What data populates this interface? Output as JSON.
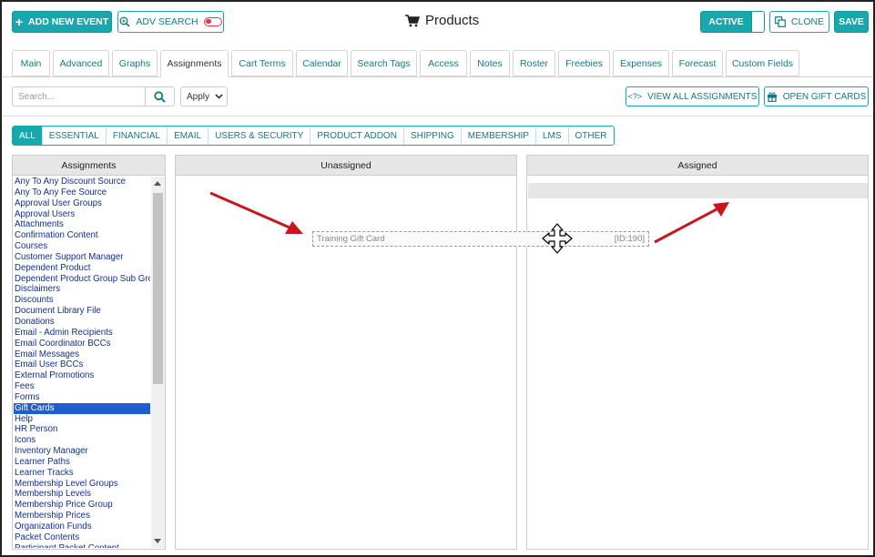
{
  "header": {
    "add_event_label": "ADD NEW EVENT",
    "adv_search_label": "ADV SEARCH",
    "title": "Products",
    "active_label": "ACTIVE",
    "clone_label": "CLONE",
    "save_label": "SAVE"
  },
  "tabs": [
    "Main",
    "Advanced",
    "Graphs",
    "Assignments",
    "Cart Terms",
    "Calendar",
    "Search Tags",
    "Access",
    "Notes",
    "Roster",
    "Freebies",
    "Expenses",
    "Forecast",
    "Custom Fields"
  ],
  "active_tab": "Assignments",
  "toolbar": {
    "search_placeholder": "Search...",
    "apply_label": "Apply",
    "view_all_label": "VIEW ALL ASSIGNMENTS",
    "view_all_glyph": "<?>",
    "gift_cards_label": "OPEN GIFT CARDS"
  },
  "filters": [
    "ALL",
    "ESSENTIAL",
    "FINANCIAL",
    "EMAIL",
    "USERS & SECURITY",
    "PRODUCT ADDON",
    "SHIPPING",
    "MEMBERSHIP",
    "LMS",
    "OTHER"
  ],
  "active_filter": "ALL",
  "panels": {
    "assignments_title": "Assignments",
    "unassigned_title": "Unassigned",
    "assigned_title": "Assigned"
  },
  "assignment_list": [
    "Any To Any Discount Source",
    "Any To Any Fee Source",
    "Approval User Groups",
    "Approval Users",
    "Attachments",
    "Confirmation Content",
    "Courses",
    "Customer Support Manager",
    "Dependent Product",
    "Dependent Product Group Sub Group",
    "Disclaimers",
    "Discounts",
    "Document Library File",
    "Donations",
    "Email - Admin Recipients",
    "Email Coordinator BCCs",
    "Email Messages",
    "Email User BCCs",
    "External Promotions",
    "Fees",
    "Forms",
    "Gift Cards",
    "Help",
    "HR Person",
    "Icons",
    "Inventory Manager",
    "Learner Paths",
    "Learner Tracks",
    "Membership Level Groups",
    "Membership Levels",
    "Membership Price Group",
    "Membership Prices",
    "Organization Funds",
    "Packet Contents",
    "Participant Packet Content"
  ],
  "selected_item": "Gift Cards",
  "dragged_item": {
    "name": "Training Gift Card",
    "id_label": "[ID:190]"
  },
  "colors": {
    "accent": "#17a8ad",
    "arrow": "#c8161d",
    "selection": "#1d5fd1"
  }
}
